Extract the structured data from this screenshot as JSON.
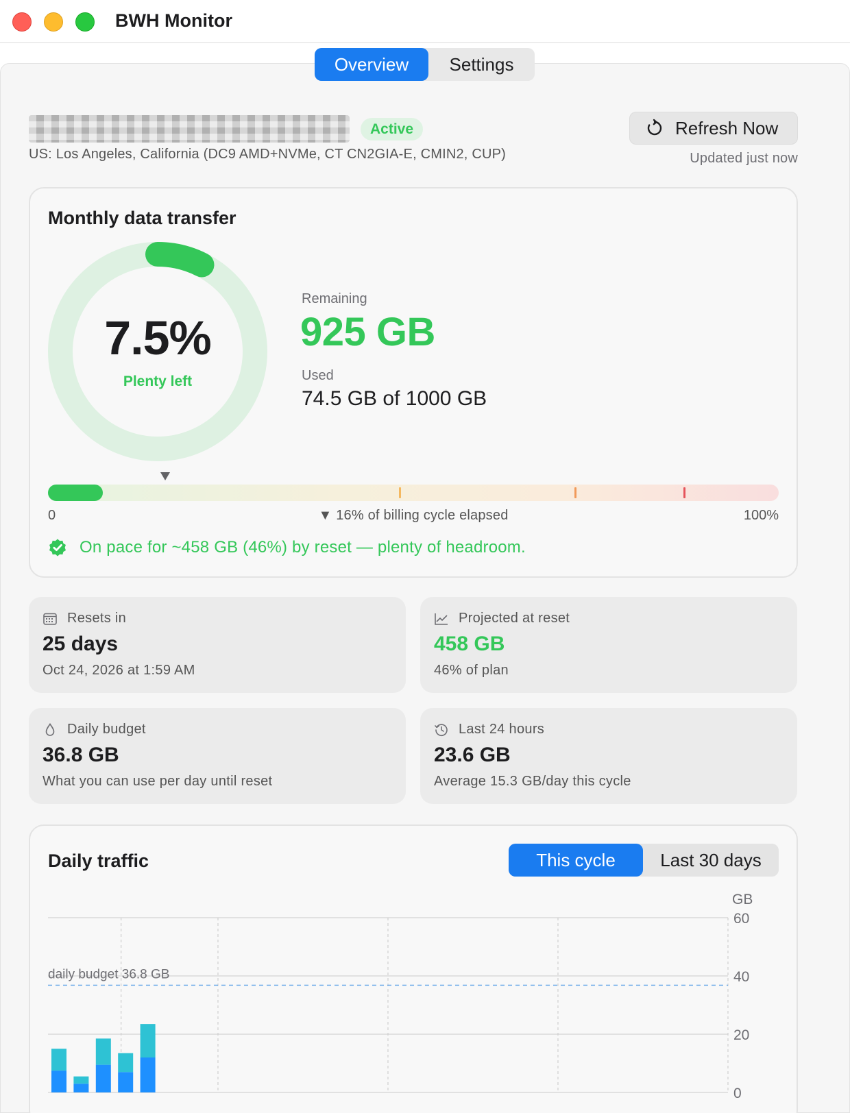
{
  "window": {
    "title": "BWH Monitor"
  },
  "tabs": {
    "overview": "Overview",
    "settings": "Settings",
    "active": "Overview"
  },
  "server": {
    "status": "Active",
    "location": "US: Los Angeles, California (DC9 AMD+NVMe, CT CN2GIA-E, CMIN2, CUP)"
  },
  "refresh": {
    "label": "Refresh Now",
    "updated": "Updated just now",
    "icon": "refresh-icon"
  },
  "monthly": {
    "title": "Monthly data transfer",
    "percent_used": "7.5%",
    "percent_used_value": 7.5,
    "status_text": "Plenty left",
    "remaining_label": "Remaining",
    "remaining_value": "925 GB",
    "used_label": "Used",
    "used_value": "74.5 GB of 1000 GB",
    "bar_scale_start": "0",
    "bar_scale_end": "100%",
    "cycle_elapsed_label": "▼ 16% of billing cycle elapsed",
    "cycle_elapsed_fraction": 0.16,
    "usage_fraction": 0.075,
    "threshold_ticks": [
      {
        "fraction": 0.48,
        "color": "#f4b860"
      },
      {
        "fraction": 0.72,
        "color": "#f19a5a"
      },
      {
        "fraction": 0.87,
        "color": "#e5545b"
      }
    ],
    "pace_text": "On pace for ~458 GB (46%) by reset — plenty of headroom.",
    "accent": "#34c759"
  },
  "stats": {
    "resets": {
      "label": "Resets in",
      "value": "25 days",
      "sub": "Oct 24, 2026 at 1:59 AM",
      "icon": "calendar-icon"
    },
    "projected": {
      "label": "Projected at reset",
      "value": "458 GB",
      "sub": "46% of plan",
      "icon": "chart-line-icon"
    },
    "budget": {
      "label": "Daily budget",
      "value": "36.8 GB",
      "sub": "What you can use per day until reset",
      "icon": "drop-icon"
    },
    "last24": {
      "label": "Last 24 hours",
      "value": "23.6 GB",
      "sub": "Average 15.3 GB/day this cycle",
      "icon": "history-icon"
    }
  },
  "traffic": {
    "title": "Daily traffic",
    "range_options": [
      "This cycle",
      "Last 30 days"
    ],
    "selected_range": "This cycle"
  },
  "chart_data": {
    "type": "bar",
    "stacked": true,
    "ylabel": "GB",
    "ylim": [
      0,
      60
    ],
    "yticks": [
      0,
      20,
      40,
      60
    ],
    "grid": true,
    "budget_line": {
      "value": 36.8,
      "label": "daily budget 36.8 GB"
    },
    "colors": {
      "series_a": "#1e90ff",
      "series_b": "#2ec2d4",
      "budget": "#6aa9e9"
    },
    "series": [
      {
        "values": [
          7.5,
          3.0,
          9.5,
          7.0,
          12.0
        ]
      },
      {
        "values": [
          7.5,
          2.5,
          9.0,
          6.5,
          11.5
        ]
      }
    ]
  }
}
